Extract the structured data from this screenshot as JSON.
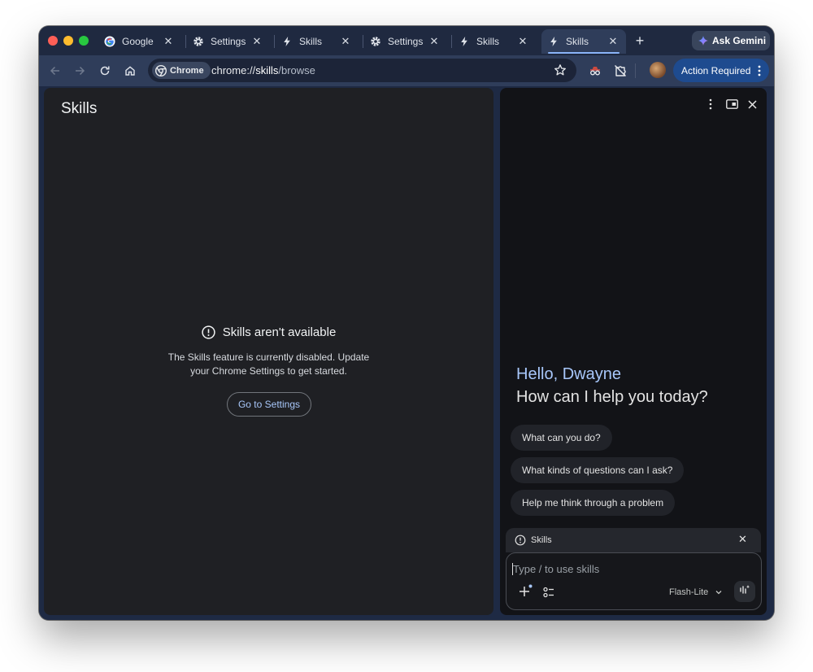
{
  "window": {
    "tabs": [
      {
        "title": "Google",
        "icon": "google-g-icon",
        "active": false
      },
      {
        "title": "Settings",
        "icon": "gear-icon",
        "active": false
      },
      {
        "title": "Skills",
        "icon": "bolt-icon",
        "active": false
      },
      {
        "title": "Settings",
        "icon": "gear-icon",
        "active": false
      },
      {
        "title": "Skills",
        "icon": "bolt-icon",
        "active": false
      },
      {
        "title": "Skills",
        "icon": "bolt-icon",
        "active": true
      }
    ],
    "ask_gemini_label": "Ask Gemini"
  },
  "toolbar": {
    "chip_label": "Chrome",
    "url_scheme": "chrome://",
    "url_host": "skills",
    "url_path": "/browse",
    "action_required_label": "Action Required"
  },
  "main": {
    "heading": "Skills",
    "notice_title": "Skills aren't available",
    "notice_line1": "The Skills feature is currently disabled. Update",
    "notice_line2": "your Chrome Settings to get started.",
    "settings_button": "Go to Settings"
  },
  "side_panel": {
    "greeting": "Hello, Dwayne",
    "question": "How can I help you today?",
    "suggestions": [
      "What can you do?",
      "What kinds of questions can I ask?",
      "Help me think through a problem"
    ],
    "skills_bar_label": "Skills",
    "input_placeholder": "Type / to use skills",
    "model_label": "Flash-Lite"
  },
  "colors": {
    "accent": "#a8c7fa",
    "frame": "#1f2940",
    "toolbar": "#2f3d5a",
    "action_button": "#1e4b8f"
  }
}
